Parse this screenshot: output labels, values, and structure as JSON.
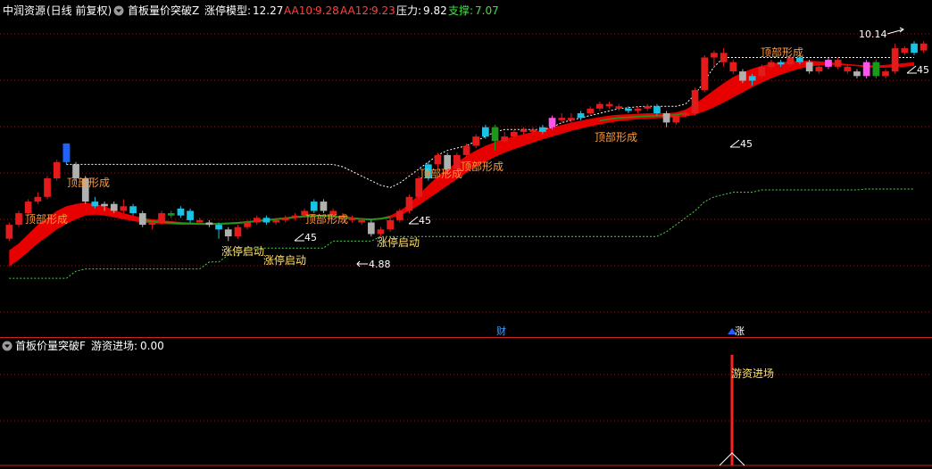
{
  "header_main": {
    "stock": "中润资源",
    "period": "(日线 前复权)",
    "indicator": "首板量价突破Z",
    "model_label": "涨停模型:",
    "model_value": "12.27",
    "aa10_label": "AA10:",
    "aa10_value": "9.28",
    "aa12_label": "AA12:",
    "aa12_value": "9.23",
    "pressure_label": "压力:",
    "pressure_value": "9.82",
    "support_label": "支撑:",
    "support_value": "7.07"
  },
  "header_sub": {
    "indicator": "首板价量突破F",
    "value_label": "游资进场:",
    "value": "0.00"
  },
  "annotations": {
    "top_formed": "顶部形成",
    "limit_up_start": "涨停启动",
    "angle_45": "45",
    "high_mark": "10.14",
    "low_mark": "4.88",
    "finance_marker": "财",
    "rise_marker": "涨",
    "entry_label": "游资进场"
  },
  "colors": {
    "up": "#e31b1b",
    "down": "#19c3e6",
    "ribbon": "#e60000",
    "ribbon_green": "#1a9a1a",
    "support_line": "#4fd04f",
    "pressure_line": "#ffffff",
    "grid": "#8a1a1a",
    "panel_divider": "#cc2222",
    "text_orange": "#ff9a3c",
    "text_yellow": "#ffe066",
    "text_red": "#ff4040",
    "text_green": "#40e040",
    "text_white": "#ffffff",
    "bar_pink": "#ff55ee",
    "bar_blue": "#2060ff",
    "bar_gray": "#b0b0b0"
  },
  "chart_data": {
    "type": "candlestick",
    "ylim": [
      4.0,
      10.6
    ],
    "candles": [
      [
        6.0,
        6.3,
        5.95,
        6.35,
        "up"
      ],
      [
        6.3,
        6.55,
        6.25,
        6.6,
        "up"
      ],
      [
        6.55,
        6.8,
        6.5,
        6.85,
        "up"
      ],
      [
        6.8,
        6.9,
        6.75,
        7.0,
        "up"
      ],
      [
        6.9,
        7.3,
        6.85,
        7.35,
        "up"
      ],
      [
        7.3,
        7.65,
        7.25,
        7.7,
        "up"
      ],
      [
        7.65,
        8.0,
        7.6,
        8.05,
        "blue"
      ],
      [
        7.6,
        7.3,
        7.25,
        7.65,
        "gray"
      ],
      [
        7.3,
        6.8,
        6.75,
        7.35,
        "gray"
      ],
      [
        6.8,
        6.7,
        6.65,
        6.9,
        "down"
      ],
      [
        6.7,
        6.75,
        6.6,
        6.8,
        "gray"
      ],
      [
        6.75,
        6.6,
        6.55,
        6.8,
        "gray"
      ],
      [
        6.6,
        6.7,
        6.55,
        6.85,
        "up"
      ],
      [
        6.7,
        6.55,
        6.5,
        6.75,
        "down"
      ],
      [
        6.55,
        6.3,
        6.25,
        6.6,
        "gray"
      ],
      [
        6.3,
        6.35,
        6.2,
        6.4,
        "up"
      ],
      [
        6.35,
        6.55,
        6.3,
        6.6,
        "up"
      ],
      [
        6.55,
        6.5,
        6.45,
        6.6,
        "green"
      ],
      [
        6.5,
        6.65,
        6.45,
        6.7,
        "down"
      ],
      [
        6.6,
        6.4,
        6.35,
        6.65,
        "blue"
      ],
      [
        6.4,
        6.35,
        6.3,
        6.45,
        "up"
      ],
      [
        6.35,
        6.3,
        6.25,
        6.4,
        "gray"
      ],
      [
        6.3,
        6.2,
        6.0,
        6.35,
        "down"
      ],
      [
        6.2,
        6.05,
        5.95,
        6.25,
        "gray"
      ],
      [
        6.05,
        6.25,
        6.0,
        6.3,
        "up"
      ],
      [
        6.25,
        6.35,
        6.2,
        6.4,
        "up"
      ],
      [
        6.35,
        6.45,
        6.3,
        6.5,
        "up"
      ],
      [
        6.45,
        6.35,
        6.3,
        6.5,
        "down"
      ],
      [
        6.35,
        6.4,
        6.3,
        6.45,
        "up"
      ],
      [
        6.4,
        6.45,
        6.35,
        6.5,
        "up"
      ],
      [
        6.45,
        6.5,
        6.4,
        6.55,
        "up"
      ],
      [
        6.5,
        6.6,
        6.45,
        6.65,
        "up"
      ],
      [
        6.6,
        6.8,
        6.55,
        6.85,
        "blue"
      ],
      [
        6.8,
        6.6,
        6.55,
        6.85,
        "gray"
      ],
      [
        6.6,
        6.5,
        6.45,
        6.65,
        "up"
      ],
      [
        6.5,
        6.45,
        6.4,
        6.55,
        "up"
      ],
      [
        6.45,
        6.4,
        6.35,
        6.5,
        "up"
      ],
      [
        6.4,
        6.35,
        6.3,
        6.45,
        "up"
      ],
      [
        6.35,
        6.1,
        6.05,
        6.4,
        "gray"
      ],
      [
        6.1,
        6.2,
        6.05,
        6.25,
        "up"
      ],
      [
        6.2,
        6.4,
        6.15,
        6.45,
        "up"
      ],
      [
        6.4,
        6.6,
        6.35,
        6.65,
        "up"
      ],
      [
        6.6,
        6.9,
        6.55,
        6.95,
        "up"
      ],
      [
        6.9,
        7.3,
        6.85,
        7.35,
        "up"
      ],
      [
        7.3,
        7.6,
        7.25,
        7.65,
        "blue"
      ],
      [
        7.6,
        7.8,
        7.5,
        7.85,
        "up"
      ],
      [
        7.8,
        7.5,
        7.4,
        7.85,
        "gray"
      ],
      [
        7.5,
        7.8,
        7.45,
        7.85,
        "up"
      ],
      [
        7.8,
        8.0,
        7.75,
        8.05,
        "up"
      ],
      [
        8.0,
        8.2,
        7.95,
        8.25,
        "up"
      ],
      [
        8.2,
        8.4,
        8.15,
        8.45,
        "blue"
      ],
      [
        8.4,
        8.1,
        7.9,
        8.45,
        "green"
      ],
      [
        8.1,
        8.2,
        8.05,
        8.3,
        "up"
      ],
      [
        8.2,
        8.3,
        8.15,
        8.35,
        "up"
      ],
      [
        8.3,
        8.35,
        8.25,
        8.4,
        "up"
      ],
      [
        8.35,
        8.3,
        8.25,
        8.4,
        "up"
      ],
      [
        8.3,
        8.4,
        8.25,
        8.45,
        "down"
      ],
      [
        8.4,
        8.6,
        8.35,
        8.65,
        "bar_pink"
      ],
      [
        8.6,
        8.55,
        8.5,
        8.7,
        "up"
      ],
      [
        8.55,
        8.6,
        8.5,
        8.7,
        "up"
      ],
      [
        8.6,
        8.7,
        8.55,
        8.75,
        "blue"
      ],
      [
        8.7,
        8.8,
        8.65,
        8.85,
        "up"
      ],
      [
        8.8,
        8.9,
        8.75,
        8.95,
        "up"
      ],
      [
        8.9,
        8.85,
        8.8,
        8.95,
        "up"
      ],
      [
        8.85,
        8.8,
        8.75,
        8.9,
        "up"
      ],
      [
        8.8,
        8.75,
        8.7,
        8.85,
        "blue"
      ],
      [
        8.75,
        8.8,
        8.7,
        8.85,
        "up"
      ],
      [
        8.8,
        8.85,
        8.75,
        8.9,
        "up"
      ],
      [
        8.85,
        8.7,
        8.65,
        8.9,
        "blue"
      ],
      [
        8.7,
        8.5,
        8.4,
        8.75,
        "gray"
      ],
      [
        8.5,
        8.65,
        8.45,
        8.7,
        "up"
      ],
      [
        8.65,
        8.7,
        8.6,
        8.75,
        "up"
      ],
      [
        8.7,
        9.2,
        8.65,
        9.25,
        "up"
      ],
      [
        9.2,
        9.9,
        9.15,
        9.95,
        "up"
      ],
      [
        9.9,
        10.0,
        9.7,
        10.05,
        "up"
      ],
      [
        10.0,
        9.8,
        9.7,
        10.1,
        "up"
      ],
      [
        9.8,
        9.6,
        9.55,
        9.85,
        "up"
      ],
      [
        9.6,
        9.4,
        9.35,
        9.65,
        "gray"
      ],
      [
        9.4,
        9.5,
        9.3,
        9.55,
        "blue"
      ],
      [
        9.5,
        9.7,
        9.45,
        9.75,
        "up"
      ],
      [
        9.7,
        9.8,
        9.65,
        9.85,
        "up"
      ],
      [
        9.8,
        9.75,
        9.7,
        9.85,
        "down"
      ],
      [
        9.75,
        9.9,
        9.7,
        9.95,
        "up"
      ],
      [
        9.9,
        9.8,
        9.75,
        9.95,
        "down"
      ],
      [
        9.8,
        9.6,
        9.55,
        9.85,
        "gray"
      ],
      [
        9.6,
        9.7,
        9.55,
        9.75,
        "up"
      ],
      [
        9.7,
        9.85,
        9.65,
        9.9,
        "bar_pink"
      ],
      [
        9.85,
        9.7,
        9.65,
        9.9,
        "up"
      ],
      [
        9.7,
        9.6,
        9.55,
        9.75,
        "up"
      ],
      [
        9.6,
        9.5,
        9.45,
        9.65,
        "gray"
      ],
      [
        9.5,
        9.8,
        9.45,
        9.85,
        "bar_pink"
      ],
      [
        9.8,
        9.5,
        9.45,
        9.85,
        "green"
      ],
      [
        9.5,
        9.6,
        9.45,
        9.65,
        "up"
      ],
      [
        9.6,
        10.1,
        9.55,
        10.2,
        "up"
      ],
      [
        10.1,
        10.0,
        9.95,
        10.14,
        "up"
      ],
      [
        10.0,
        10.2,
        9.95,
        10.25,
        "blue"
      ],
      [
        10.2,
        10.05,
        10.0,
        10.25,
        "up"
      ]
    ],
    "ribbon_upper": [
      5.75,
      5.9,
      6.1,
      6.3,
      6.45,
      6.6,
      6.7,
      6.75,
      6.78,
      6.75,
      6.7,
      6.62,
      6.55,
      6.5,
      6.45,
      6.42,
      6.4,
      6.38,
      6.36,
      6.35,
      6.34,
      6.34,
      6.34,
      6.35,
      6.36,
      6.38,
      6.4,
      6.42,
      6.44,
      6.46,
      6.48,
      6.5,
      6.52,
      6.52,
      6.5,
      6.48,
      6.46,
      6.44,
      6.43,
      6.45,
      6.5,
      6.6,
      6.75,
      6.95,
      7.15,
      7.35,
      7.5,
      7.65,
      7.78,
      7.9,
      8.0,
      8.08,
      8.15,
      8.2,
      8.25,
      8.3,
      8.35,
      8.4,
      8.45,
      8.5,
      8.54,
      8.58,
      8.62,
      8.65,
      8.67,
      8.68,
      8.69,
      8.7,
      8.7,
      8.7,
      8.72,
      8.78,
      8.9,
      9.05,
      9.2,
      9.35,
      9.48,
      9.58,
      9.66,
      9.72,
      9.77,
      9.8,
      9.82,
      9.83,
      9.83,
      9.82,
      9.8,
      9.78,
      9.76,
      9.74,
      9.73,
      9.73,
      9.74,
      9.76,
      9.78,
      9.8
    ],
    "ribbon_lower": [
      5.4,
      5.55,
      5.72,
      5.9,
      6.05,
      6.2,
      6.32,
      6.42,
      6.5,
      6.52,
      6.5,
      6.46,
      6.42,
      6.38,
      6.35,
      6.33,
      6.32,
      6.31,
      6.3,
      6.3,
      6.3,
      6.3,
      6.3,
      6.31,
      6.32,
      6.34,
      6.36,
      6.38,
      6.4,
      6.42,
      6.44,
      6.46,
      6.47,
      6.47,
      6.46,
      6.44,
      6.42,
      6.41,
      6.4,
      6.41,
      6.44,
      6.5,
      6.6,
      6.72,
      6.86,
      7.0,
      7.14,
      7.28,
      7.42,
      7.55,
      7.66,
      7.76,
      7.85,
      7.93,
      8.0,
      8.07,
      8.14,
      8.2,
      8.26,
      8.32,
      8.37,
      8.42,
      8.46,
      8.5,
      8.53,
      8.55,
      8.57,
      8.58,
      8.59,
      8.6,
      8.61,
      8.63,
      8.67,
      8.74,
      8.83,
      8.93,
      9.04,
      9.15,
      9.26,
      9.36,
      9.45,
      9.53,
      9.6,
      9.66,
      9.7,
      9.73,
      9.74,
      9.74,
      9.73,
      9.71,
      9.69,
      9.68,
      9.68,
      9.69,
      9.7,
      9.72
    ],
    "support": [
      5.15,
      5.15,
      5.15,
      5.15,
      5.15,
      5.15,
      5.15,
      5.3,
      5.35,
      5.35,
      5.35,
      5.35,
      5.35,
      5.35,
      5.35,
      5.35,
      5.35,
      5.35,
      5.35,
      5.35,
      5.35,
      5.5,
      5.5,
      5.65,
      5.65,
      5.8,
      5.8,
      5.8,
      5.8,
      5.8,
      5.8,
      5.8,
      5.8,
      5.8,
      5.95,
      5.95,
      5.95,
      5.95,
      5.95,
      6.05,
      6.05,
      6.05,
      6.05,
      6.05,
      6.05,
      6.05,
      6.05,
      6.05,
      6.05,
      6.05,
      6.05,
      6.05,
      6.05,
      6.05,
      6.05,
      6.05,
      6.05,
      6.05,
      6.05,
      6.05,
      6.05,
      6.05,
      6.05,
      6.05,
      6.05,
      6.05,
      6.05,
      6.05,
      6.05,
      6.15,
      6.3,
      6.45,
      6.6,
      6.8,
      6.9,
      6.95,
      7.0,
      7.0,
      7.0,
      7.05,
      7.05,
      7.05,
      7.05,
      7.05,
      7.05,
      7.05,
      7.05,
      7.05,
      7.05,
      7.05,
      7.07,
      7.07,
      7.07,
      7.07,
      7.07,
      7.07
    ],
    "pressure": [
      null,
      null,
      null,
      null,
      null,
      null,
      7.6,
      7.6,
      7.6,
      7.6,
      7.6,
      7.6,
      7.6,
      7.6,
      7.6,
      7.6,
      7.6,
      7.6,
      7.6,
      7.6,
      7.6,
      7.6,
      7.6,
      7.6,
      7.6,
      7.6,
      7.6,
      7.6,
      7.6,
      7.6,
      7.6,
      7.6,
      7.6,
      7.6,
      7.6,
      7.55,
      7.45,
      7.35,
      7.25,
      7.15,
      7.1,
      7.2,
      7.35,
      7.5,
      7.65,
      7.8,
      7.9,
      7.95,
      8.0,
      8.1,
      8.2,
      8.3,
      8.35,
      8.35,
      8.35,
      8.35,
      8.35,
      8.4,
      8.5,
      8.55,
      8.6,
      8.65,
      8.7,
      8.75,
      8.8,
      8.82,
      8.84,
      8.85,
      8.85,
      8.85,
      8.85,
      8.9,
      9.1,
      9.4,
      9.7,
      9.9,
      9.9,
      9.9,
      9.9,
      9.9,
      9.9,
      9.9,
      9.9,
      9.9,
      9.9,
      9.9,
      9.9,
      9.9,
      9.9,
      9.9,
      9.9,
      9.9,
      9.9,
      9.9,
      9.9,
      9.9
    ],
    "sub_signal_index": 80
  }
}
